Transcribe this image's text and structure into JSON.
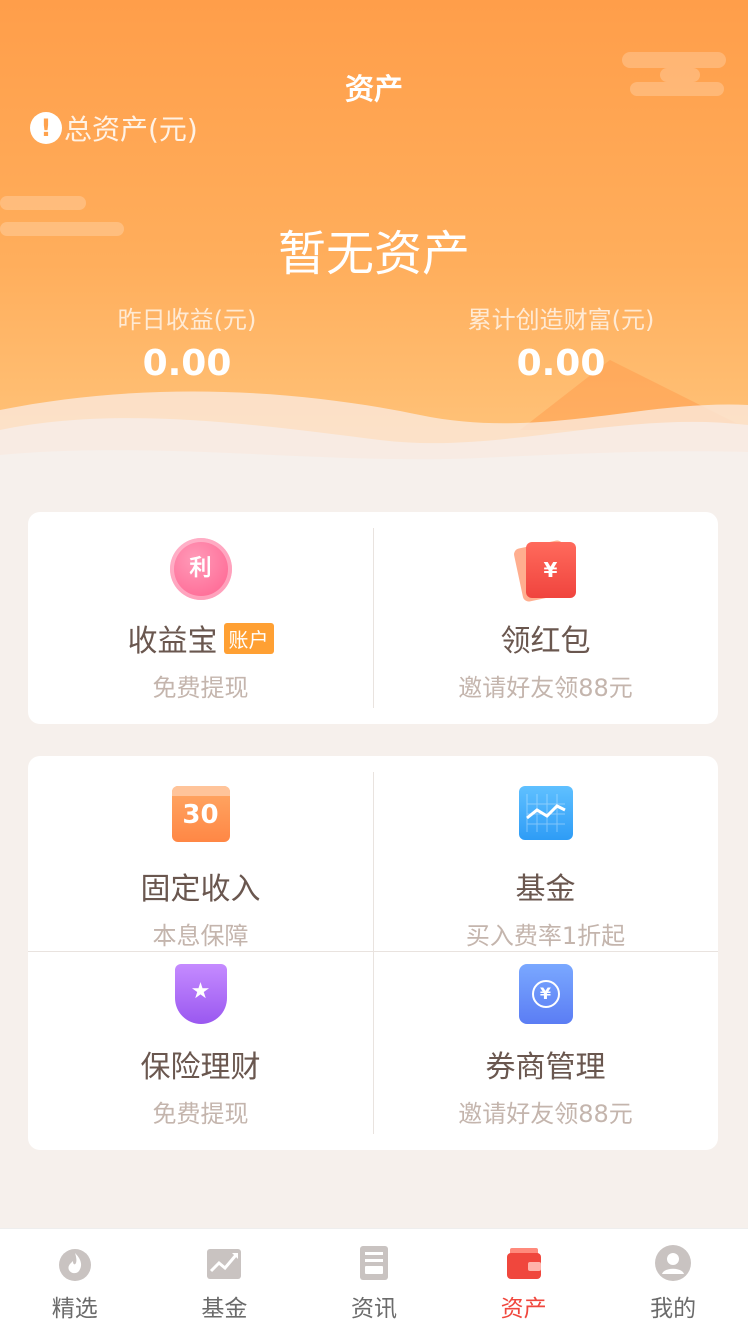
{
  "header": {
    "title": "资产",
    "total_assets_label": "总资产(元)",
    "info_icon_glyph": "!",
    "empty_text": "暂无资产",
    "stats": [
      {
        "label": "昨日收益(元)",
        "value": "0.00"
      },
      {
        "label": "累计创造财富(元)",
        "value": "0.00"
      }
    ]
  },
  "card1": {
    "items": [
      {
        "icon": "interest-coin-icon",
        "icon_glyph": "利",
        "title": "收益宝",
        "badge": "账户",
        "subtitle": "免费提现"
      },
      {
        "icon": "red-envelope-icon",
        "icon_glyph": "¥",
        "title": "领红包",
        "subtitle": "邀请好友领88元"
      }
    ]
  },
  "card2": {
    "items": [
      {
        "icon": "calendar-icon",
        "icon_glyph": "30",
        "title": "固定收入",
        "subtitle": "本息保障"
      },
      {
        "icon": "fund-chart-icon",
        "title": "基金",
        "subtitle": "买入费率1折起"
      },
      {
        "icon": "shield-star-icon",
        "icon_glyph": "★",
        "title": "保险理财",
        "subtitle": "免费提现"
      },
      {
        "icon": "ticket-icon",
        "icon_glyph": "¥",
        "title": "券商管理",
        "subtitle": "邀请好友领88元"
      }
    ]
  },
  "tabbar": {
    "active_index": 3,
    "active_color": "#f0473d",
    "tabs": [
      {
        "label": "精选",
        "icon": "flame-icon"
      },
      {
        "label": "基金",
        "icon": "trend-chart-icon"
      },
      {
        "label": "资讯",
        "icon": "news-icon"
      },
      {
        "label": "资产",
        "icon": "wallet-icon"
      },
      {
        "label": "我的",
        "icon": "profile-icon"
      }
    ]
  },
  "colors": {
    "header_top": "#ff9e4a",
    "header_bottom": "#ffc77f",
    "background": "#f6f0ec",
    "badge": "#ffa033"
  }
}
